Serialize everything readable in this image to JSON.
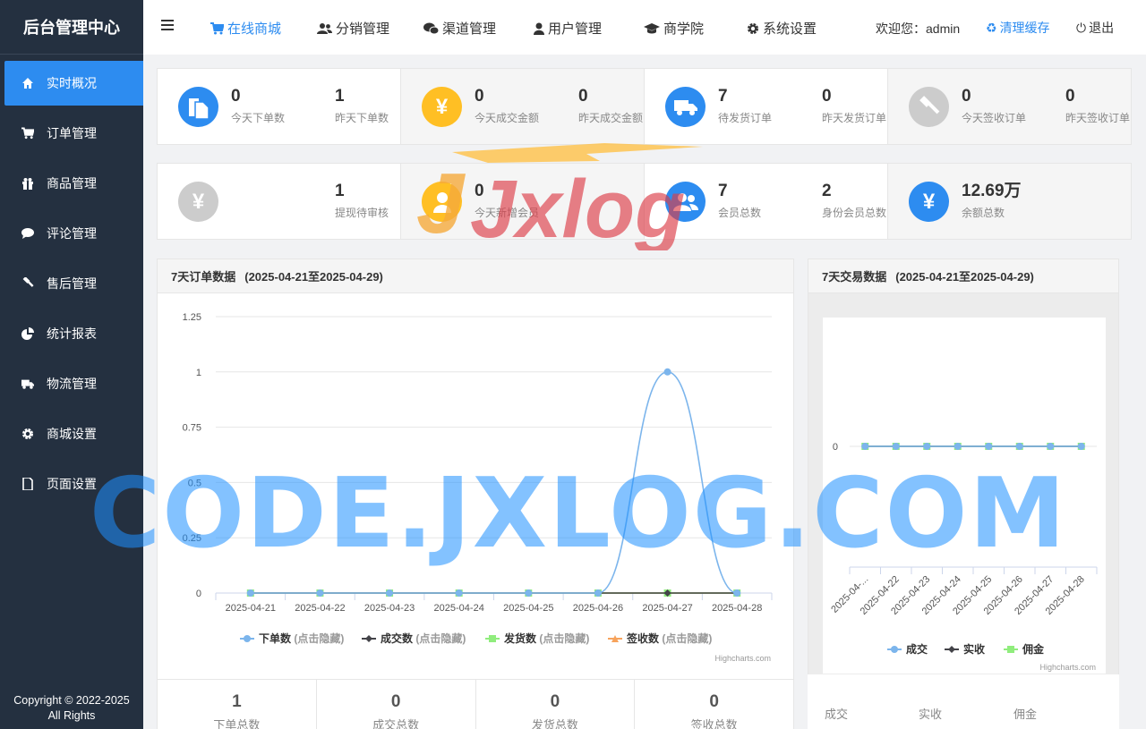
{
  "brand": "后台管理中心",
  "sidebar": {
    "items": [
      {
        "label": "实时概况",
        "icon": "home-icon",
        "active": true
      },
      {
        "label": "订单管理",
        "icon": "cart-icon",
        "active": false
      },
      {
        "label": "商品管理",
        "icon": "gift-icon",
        "active": false
      },
      {
        "label": "评论管理",
        "icon": "comment-icon",
        "active": false
      },
      {
        "label": "售后管理",
        "icon": "gavel-icon",
        "active": false
      },
      {
        "label": "统计报表",
        "icon": "pie-chart-icon",
        "active": false
      },
      {
        "label": "物流管理",
        "icon": "truck-icon",
        "active": false
      },
      {
        "label": "商城设置",
        "icon": "gear-icon",
        "active": false
      },
      {
        "label": "页面设置",
        "icon": "file-icon",
        "active": false
      }
    ],
    "copyright_line1": "Copyright © 2022-2025",
    "copyright_line2": "All Rights"
  },
  "topbar": {
    "nav": [
      {
        "label": "在线商城",
        "icon": "cart-icon",
        "active": true
      },
      {
        "label": "分销管理",
        "icon": "users-icon",
        "active": false
      },
      {
        "label": "渠道管理",
        "icon": "wechat-icon",
        "active": false
      },
      {
        "label": "用户管理",
        "icon": "user-icon",
        "active": false
      },
      {
        "label": "商学院",
        "icon": "graduation-cap-icon",
        "active": false
      },
      {
        "label": "系统设置",
        "icon": "gear-icon",
        "active": false
      }
    ],
    "welcome": "欢迎您：admin",
    "clear_cache": "清理缓存",
    "logout": "退出"
  },
  "stats_row1": [
    {
      "icon": "file-icon",
      "color": "#2d8cf0",
      "a_val": "0",
      "a_lbl": "今天下单数",
      "b_val": "1",
      "b_lbl": "昨天下单数"
    },
    {
      "icon": "yen-icon",
      "color": "#ffbf24",
      "a_val": "0",
      "a_lbl": "今天成交金额",
      "b_val": "0",
      "b_lbl": "昨天成交金额"
    },
    {
      "icon": "truck-icon",
      "color": "#2d8cf0",
      "a_val": "7",
      "a_lbl": "待发货订单",
      "b_val": "0",
      "b_lbl": "昨天发货订单"
    },
    {
      "icon": "gavel-icon",
      "color": "#cccccc",
      "a_val": "0",
      "a_lbl": "今天签收订单",
      "b_val": "0",
      "b_lbl": "昨天签收订单"
    }
  ],
  "stats_row2": [
    {
      "icon": "yen-icon",
      "color": "#cccccc",
      "a_val": "",
      "a_lbl": "",
      "b_val": "1",
      "b_lbl": "提现待审核"
    },
    {
      "icon": "user-icon",
      "color": "#ffbf24",
      "a_val": "0",
      "a_lbl": "今天新增会员",
      "b_val": "",
      "b_lbl": ""
    },
    {
      "icon": "users-icon",
      "color": "#2d8cf0",
      "a_val": "7",
      "a_lbl": "会员总数",
      "b_val": "2",
      "b_lbl": "身份会员总数"
    },
    {
      "icon": "yen-icon",
      "color": "#2d8cf0",
      "a_val": "12.69万",
      "a_lbl": "余额总数",
      "b_val": "",
      "b_lbl": ""
    }
  ],
  "order_panel": {
    "title": "7天订单数据",
    "range": "(2025-04-21至2025-04-29)"
  },
  "trade_panel": {
    "title": "7天交易数据",
    "range": "(2025-04-21至2025-04-29)"
  },
  "summary": [
    {
      "value": "1",
      "label": "下单总数"
    },
    {
      "value": "0",
      "label": "成交总数"
    },
    {
      "value": "0",
      "label": "发货总数"
    },
    {
      "value": "0",
      "label": "签收总数"
    }
  ],
  "trade_foot": {
    "col1": "成交",
    "col2": "实收",
    "col3": "佣金"
  },
  "watermarks": {
    "code": "CODE.JXLOG.COM",
    "logo": "Jxlog"
  },
  "chart_data": [
    {
      "type": "line",
      "categories": [
        "2025-04-21",
        "2025-04-22",
        "2025-04-23",
        "2025-04-24",
        "2025-04-25",
        "2025-04-26",
        "2025-04-27",
        "2025-04-28"
      ],
      "ylim": [
        0,
        1.25
      ],
      "yticks": [
        "0",
        "0.25",
        "0.5",
        "0.75",
        "1",
        "1.25"
      ],
      "credits": "Highcharts.com",
      "legend_suffix": "(点击隐藏)",
      "series": [
        {
          "name": "下单数",
          "color": "#7cb5ec",
          "marker": "circle",
          "values": [
            0,
            0,
            0,
            0,
            0,
            0,
            1,
            0
          ]
        },
        {
          "name": "成交数",
          "color": "#434348",
          "marker": "diamond",
          "values": [
            0,
            0,
            0,
            0,
            0,
            0,
            0,
            0
          ]
        },
        {
          "name": "发货数",
          "color": "#90ed7d",
          "marker": "square",
          "values": [
            0,
            0,
            0,
            0,
            0,
            0,
            0,
            0
          ]
        },
        {
          "name": "签收数",
          "color": "#f7a35c",
          "marker": "triangle",
          "values": [
            0,
            0,
            0,
            0,
            0,
            0,
            0,
            0
          ]
        }
      ]
    },
    {
      "type": "line",
      "categories": [
        "2025-04-...",
        "2025-04-22",
        "2025-04-23",
        "2025-04-24",
        "2025-04-25",
        "2025-04-26",
        "2025-04-27",
        "2025-04-28"
      ],
      "yticks": [
        "0"
      ],
      "credits": "Highcharts.com",
      "series": [
        {
          "name": "成交",
          "color": "#7cb5ec",
          "marker": "circle",
          "values": [
            0,
            0,
            0,
            0,
            0,
            0,
            0,
            0
          ]
        },
        {
          "name": "实收",
          "color": "#434348",
          "marker": "diamond",
          "values": [
            0,
            0,
            0,
            0,
            0,
            0,
            0,
            0
          ]
        },
        {
          "name": "佣金",
          "color": "#90ed7d",
          "marker": "square",
          "values": [
            0,
            0,
            0,
            0,
            0,
            0,
            0,
            0
          ]
        }
      ]
    }
  ]
}
